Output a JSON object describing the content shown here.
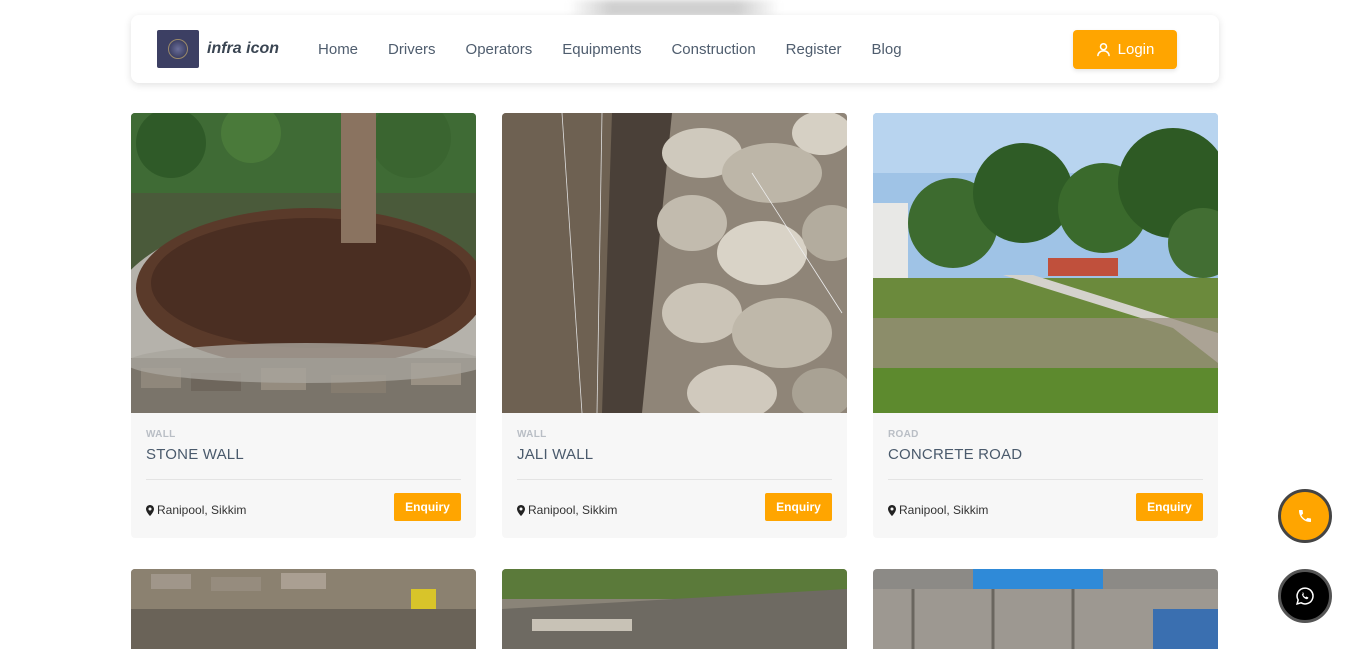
{
  "brand": {
    "name": "infra icon",
    "logo_icon": "infra-icon-logo"
  },
  "nav": {
    "links": [
      "Home",
      "Drivers",
      "Operators",
      "Equipments",
      "Construction",
      "Register",
      "Blog"
    ],
    "login_label": "Login",
    "login_icon": "user-icon"
  },
  "cards": [
    {
      "category": "WALL",
      "title": "STONE WALL",
      "location": "Ranipool, Sikkim",
      "button": "Enquiry"
    },
    {
      "category": "WALL",
      "title": "JALI WALL",
      "location": "Ranipool, Sikkim",
      "button": "Enquiry"
    },
    {
      "category": "ROAD",
      "title": "CONCRETE ROAD",
      "location": "Ranipool, Sikkim",
      "button": "Enquiry"
    }
  ],
  "floating": {
    "call_icon": "phone-icon",
    "whatsapp_icon": "whatsapp-icon"
  },
  "colors": {
    "accent": "#ffa500",
    "nav_text": "#4f5d6e",
    "card_bg": "#f7f7f7"
  }
}
